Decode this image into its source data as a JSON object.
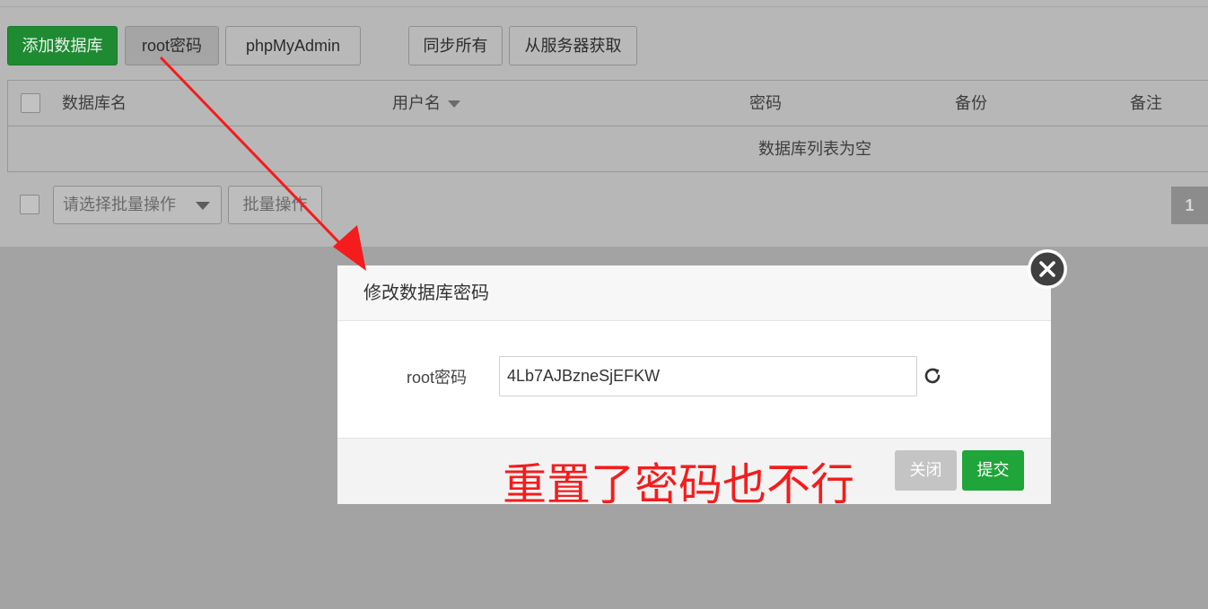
{
  "toolbar": {
    "add_db": "添加数据库",
    "root_pwd": "root密码",
    "phpmyadmin": "phpMyAdmin",
    "sync_all": "同步所有",
    "fetch_from_server": "从服务器获取"
  },
  "table": {
    "columns": [
      "数据库名",
      "用户名",
      "密码",
      "备份",
      "备注"
    ],
    "empty_text": "数据库列表为空"
  },
  "batch": {
    "select_placeholder": "请选择批量操作",
    "button": "批量操作"
  },
  "pagination": {
    "current": "1"
  },
  "dialog": {
    "title": "修改数据库密码",
    "field_label": "root密码",
    "password_value": "4Lb7AJBzneSjEFKW",
    "close_label": "关闭",
    "submit_label": "提交"
  },
  "annotation": {
    "text": "重置了密码也不行",
    "color": "#f41c1c"
  },
  "colors": {
    "primary": "#20a53a",
    "overlay": "#a3a3a3"
  }
}
